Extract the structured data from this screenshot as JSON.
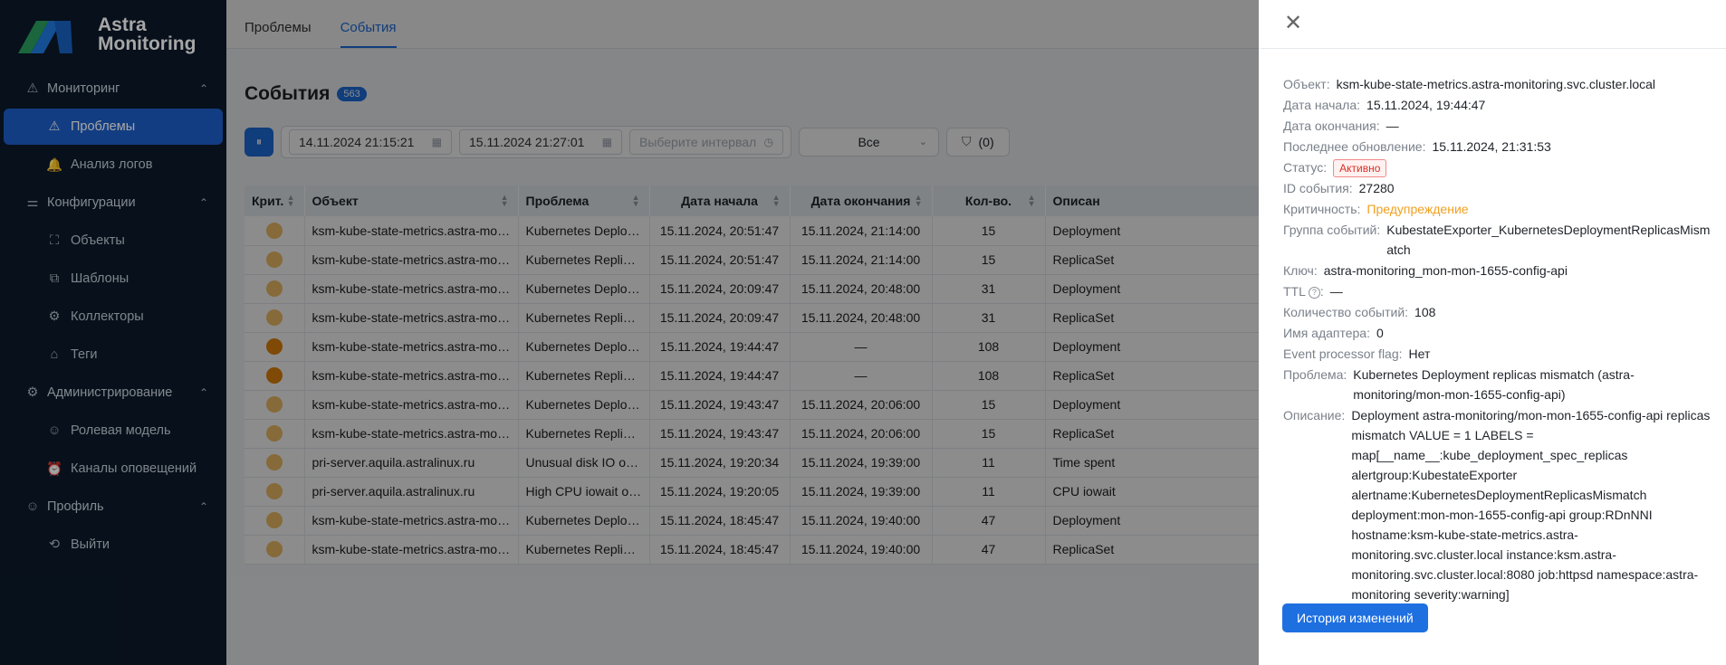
{
  "app": {
    "name_line1": "Astra",
    "name_line2": "Monitoring"
  },
  "sidebar": {
    "sections": [
      {
        "label": "Мониторинг",
        "icon": "warning-triangle-icon",
        "items": [
          {
            "label": "Проблемы",
            "icon": "warning-triangle-icon",
            "active": true
          },
          {
            "label": "Анализ логов",
            "icon": "bell-icon"
          }
        ]
      },
      {
        "label": "Конфигурации",
        "icon": "sliders-icon",
        "items": [
          {
            "label": "Объекты",
            "icon": "frame-icon"
          },
          {
            "label": "Шаблоны",
            "icon": "copy-icon"
          },
          {
            "label": "Коллекторы",
            "icon": "collector-icon"
          },
          {
            "label": "Теги",
            "icon": "tag-icon"
          }
        ]
      },
      {
        "label": "Администрирование",
        "icon": "gear-icon",
        "items": [
          {
            "label": "Ролевая модель",
            "icon": "users-icon"
          },
          {
            "label": "Каналы оповещений",
            "icon": "alarm-icon"
          }
        ]
      },
      {
        "label": "Профиль",
        "icon": "user-icon",
        "items": [
          {
            "label": "Выйти",
            "icon": "logout-icon"
          }
        ]
      }
    ]
  },
  "tabs": [
    {
      "label": "Проблемы",
      "active": false
    },
    {
      "label": "События",
      "active": true
    }
  ],
  "page": {
    "title": "События",
    "count": "563"
  },
  "filters": {
    "date_from": "14.11.2024 21:15:21",
    "date_to": "15.11.2024 21:27:01",
    "interval_placeholder": "Выберите интервал",
    "select_value": "Все",
    "filter_count": "(0)"
  },
  "table": {
    "columns": [
      "Крит.",
      "Объект",
      "Проблема",
      "Дата начала",
      "Дата окончания",
      "Кол-во.",
      "Описан"
    ],
    "rows": [
      {
        "sev": "warning",
        "object": "ksm-kube-state-metrics.astra-monitoring.svc.cluster.local",
        "problem": "Kubernetes Deployment replicas mismatch",
        "start": "15.11.2024, 20:51:47",
        "end": "15.11.2024, 21:14:00",
        "count": "15",
        "desc": "Deployment"
      },
      {
        "sev": "warning",
        "object": "ksm-kube-state-metrics.astra-monitoring.svc.cluster.local",
        "problem": "Kubernetes ReplicasSet mismatch",
        "start": "15.11.2024, 20:51:47",
        "end": "15.11.2024, 21:14:00",
        "count": "15",
        "desc": "ReplicaSet"
      },
      {
        "sev": "warning",
        "object": "ksm-kube-state-metrics.astra-monitoring.svc.cluster.local",
        "problem": "Kubernetes Deployment replicas mismatch",
        "start": "15.11.2024, 20:09:47",
        "end": "15.11.2024, 20:48:00",
        "count": "31",
        "desc": "Deployment"
      },
      {
        "sev": "warning",
        "object": "ksm-kube-state-metrics.astra-monitoring.svc.cluster.local",
        "problem": "Kubernetes ReplicasSet mismatch",
        "start": "15.11.2024, 20:09:47",
        "end": "15.11.2024, 20:48:00",
        "count": "31",
        "desc": "ReplicaSet"
      },
      {
        "sev": "high",
        "object": "ksm-kube-state-metrics.astra-monitoring.svc.cluster.local",
        "problem": "Kubernetes Deployment replicas mismatch",
        "start": "15.11.2024, 19:44:47",
        "end": "—",
        "count": "108",
        "desc": "Deployment"
      },
      {
        "sev": "high",
        "object": "ksm-kube-state-metrics.astra-monitoring.svc.cluster.local",
        "problem": "Kubernetes ReplicasSet mismatch",
        "start": "15.11.2024, 19:44:47",
        "end": "—",
        "count": "108",
        "desc": "ReplicaSet"
      },
      {
        "sev": "warning",
        "object": "ksm-kube-state-metrics.astra-monitoring.svc.cluster.local",
        "problem": "Kubernetes Deployment replicas mismatch",
        "start": "15.11.2024, 19:43:47",
        "end": "15.11.2024, 20:06:00",
        "count": "15",
        "desc": "Deployment"
      },
      {
        "sev": "warning",
        "object": "ksm-kube-state-metrics.astra-monitoring.svc.cluster.local",
        "problem": "Kubernetes ReplicasSet mismatch",
        "start": "15.11.2024, 19:43:47",
        "end": "15.11.2024, 20:06:00",
        "count": "15",
        "desc": "ReplicaSet"
      },
      {
        "sev": "warning",
        "object": "pri-server.aquila.astralinux.ru",
        "problem": "Unusual disk IO on pri-server",
        "start": "15.11.2024, 19:20:34",
        "end": "15.11.2024, 19:39:00",
        "count": "11",
        "desc": "Time spent"
      },
      {
        "sev": "warning",
        "object": "pri-server.aquila.astralinux.ru",
        "problem": "High CPU iowait on pri-server",
        "start": "15.11.2024, 19:20:05",
        "end": "15.11.2024, 19:39:00",
        "count": "11",
        "desc": "CPU iowait"
      },
      {
        "sev": "warning",
        "object": "ksm-kube-state-metrics.astra-monitoring.svc.cluster.local",
        "problem": "Kubernetes Deployment replicas mismatch",
        "start": "15.11.2024, 18:45:47",
        "end": "15.11.2024, 19:40:00",
        "count": "47",
        "desc": "Deployment"
      },
      {
        "sev": "warning",
        "object": "ksm-kube-state-metrics.astra-monitoring.svc.cluster.local",
        "problem": "Kubernetes ReplicasSet mismatch",
        "start": "15.11.2024, 18:45:47",
        "end": "15.11.2024, 19:40:00",
        "count": "47",
        "desc": "ReplicaSet"
      }
    ]
  },
  "drawer": {
    "fields": [
      {
        "label": "Объект",
        "value": "ksm-kube-state-metrics.astra-monitoring.svc.cluster.local"
      },
      {
        "label": "Дата начала",
        "value": "15.11.2024, 19:44:47"
      },
      {
        "label": "Дата окончания",
        "value": "—"
      },
      {
        "label": "Последнее обновление",
        "value": "15.11.2024, 21:31:53"
      },
      {
        "label": "Статус",
        "value": "Активно",
        "kind": "status"
      },
      {
        "label": "ID события",
        "value": "27280"
      },
      {
        "label": "Критичность",
        "value": "Предупреждение",
        "kind": "warn"
      },
      {
        "label": "Группа событий",
        "value": "KubestateExporter_KubernetesDeploymentReplicasMismatch"
      },
      {
        "label": "Ключ",
        "value": "astra-monitoring_mon-mon-1655-config-api"
      },
      {
        "label": "TTL",
        "value": "—",
        "kind": "help"
      },
      {
        "label": "Количество событий",
        "value": "108"
      },
      {
        "label": "Имя адаптера",
        "value": "0"
      },
      {
        "label": "Event processor flag",
        "value": "Нет"
      },
      {
        "label": "Проблема",
        "value": "Kubernetes Deployment replicas mismatch (astra-monitoring/mon-mon-1655-config-api)"
      },
      {
        "label": "Описание",
        "value": "Deployment astra-monitoring/mon-mon-1655-config-api replicas mismatch VALUE = 1 LABELS = map[__name__:kube_deployment_spec_replicas alertgroup:KubestateExporter alertname:KubernetesDeploymentReplicasMismatch deployment:mon-mon-1655-config-api group:RDnNNI hostname:ksm-kube-state-metrics.astra-monitoring.svc.cluster.local instance:ksm.astra-monitoring.svc.cluster.local:8080 job:httpsd namespace:astra-monitoring severity:warning]"
      }
    ],
    "history_button": "История изменений",
    "close_icon": "close-icon"
  },
  "colors": {
    "accent": "#1e6fe0",
    "sidebar_bg": "#0b1a2a",
    "warning_dot": "#f5c26b",
    "high_dot": "#e8860b",
    "status_red": "#d93026"
  }
}
